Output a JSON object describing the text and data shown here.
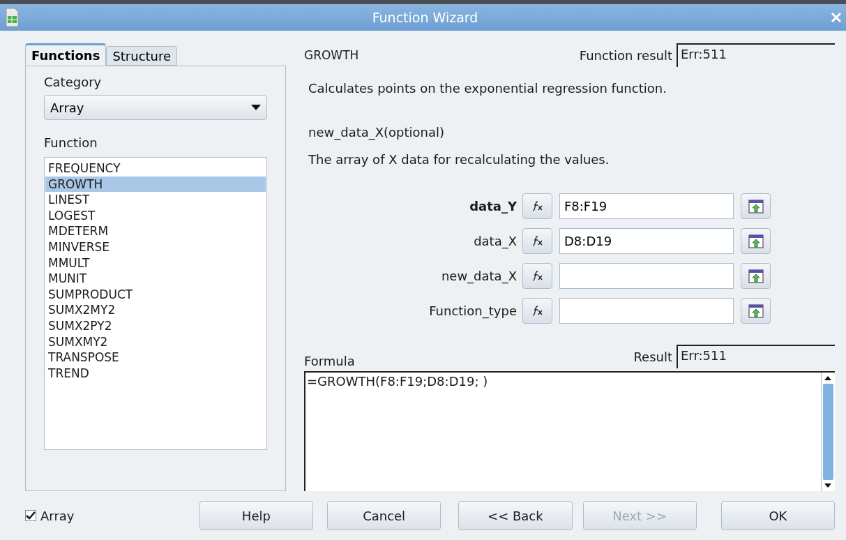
{
  "window": {
    "title": "Function Wizard"
  },
  "tabs": [
    {
      "label": "Functions",
      "selected": true
    },
    {
      "label": "Structure",
      "selected": false
    }
  ],
  "category": {
    "label": "Category",
    "value": "Array"
  },
  "function_list": {
    "label": "Function",
    "items": [
      {
        "label": "FREQUENCY",
        "selected": false
      },
      {
        "label": "GROWTH",
        "selected": true
      },
      {
        "label": "LINEST",
        "selected": false
      },
      {
        "label": "LOGEST",
        "selected": false
      },
      {
        "label": "MDETERM",
        "selected": false
      },
      {
        "label": "MINVERSE",
        "selected": false
      },
      {
        "label": "MMULT",
        "selected": false
      },
      {
        "label": "MUNIT",
        "selected": false
      },
      {
        "label": "SUMPRODUCT",
        "selected": false
      },
      {
        "label": "SUMX2MY2",
        "selected": false
      },
      {
        "label": "SUMX2PY2",
        "selected": false
      },
      {
        "label": "SUMXMY2",
        "selected": false
      },
      {
        "label": "TRANSPOSE",
        "selected": false
      },
      {
        "label": "TREND",
        "selected": false
      }
    ]
  },
  "function_name": "GROWTH",
  "function_result": {
    "label": "Function result",
    "value": "Err:511"
  },
  "description": "Calculates points on the exponential regression function.",
  "argument_name": "new_data_X(optional)",
  "argument_description": "The array of X data for recalculating the values.",
  "arguments": [
    {
      "label": "data_Y",
      "value": "F8:F19",
      "bold": true
    },
    {
      "label": "data_X",
      "value": "D8:D19",
      "bold": false
    },
    {
      "label": "new_data_X",
      "bold": false
    },
    {
      "label": "Function_type",
      "bold": false
    }
  ],
  "formula": {
    "label": "Formula",
    "value": "=GROWTH(F8:F19;D8:D19; )"
  },
  "result": {
    "label": "Result",
    "value": "Err:511"
  },
  "array_checkbox": {
    "label": "Array",
    "checked": true
  },
  "buttons": [
    {
      "label": "Help",
      "disabled": false
    },
    {
      "label": "Cancel",
      "disabled": false
    },
    {
      "label": "<< Back",
      "disabled": false
    },
    {
      "label": "Next >>",
      "disabled": true
    },
    {
      "label": "OK",
      "disabled": false
    }
  ]
}
